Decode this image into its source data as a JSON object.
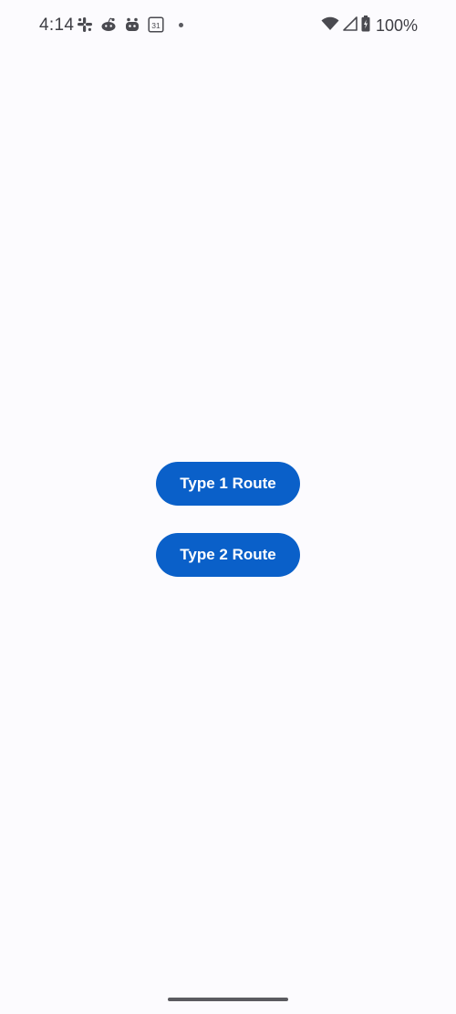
{
  "status_bar": {
    "time": "4:14",
    "notification_icons": [
      "slack-icon",
      "reddit-icon",
      "bot-icon",
      "calendar-icon"
    ],
    "calendar_day": "31",
    "battery_percent": "100%",
    "system_icons": [
      "wifi-icon",
      "cellular-icon",
      "battery-charging-icon"
    ]
  },
  "buttons": {
    "type1_label": "Type 1 Route",
    "type2_label": "Type 2 Route"
  },
  "colors": {
    "background": "#fcfbfe",
    "button": "#0a60c9",
    "button_text": "#ffffff",
    "status_text": "#3e3e44"
  }
}
